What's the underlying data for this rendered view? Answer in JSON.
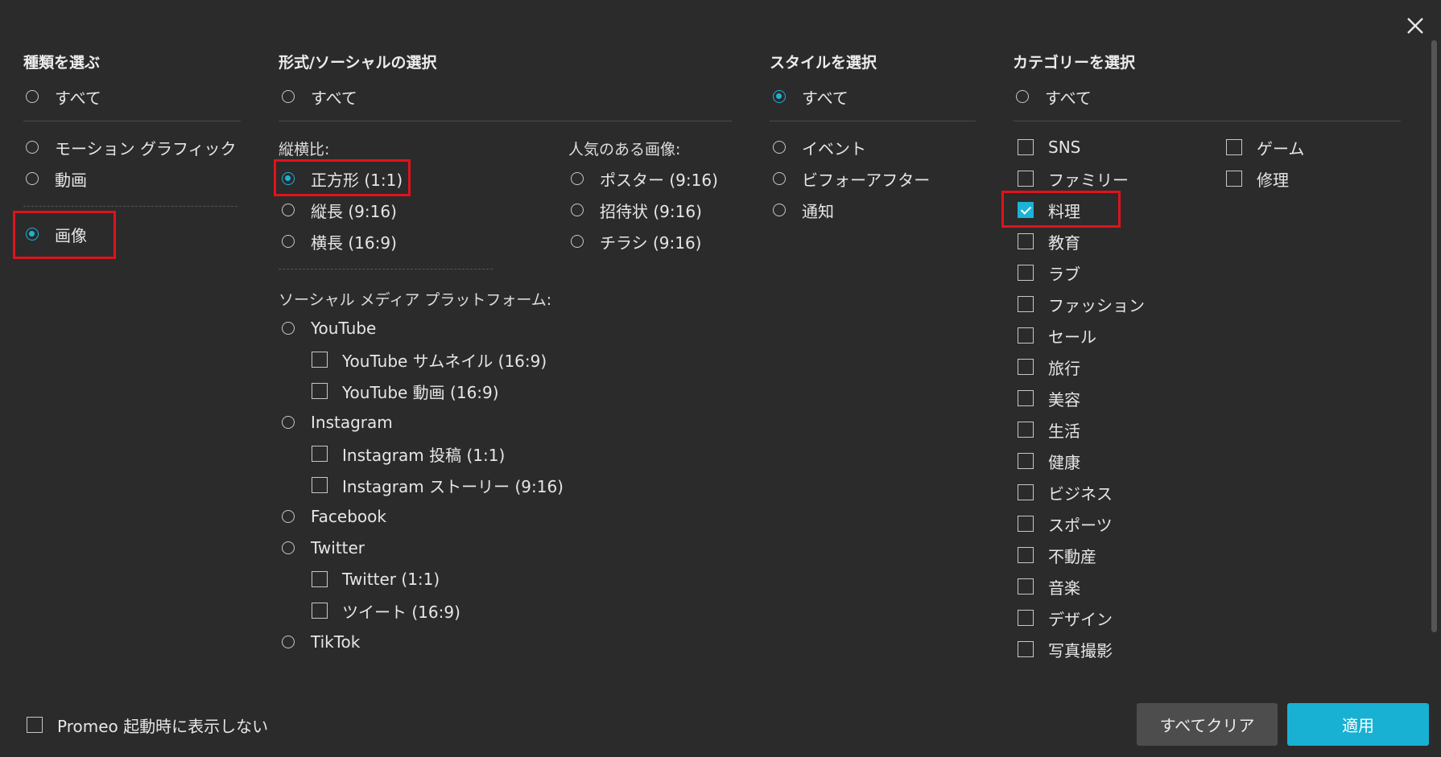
{
  "colors": {
    "accent": "#1bb3d6",
    "highlight": "#e0121b",
    "background": "#2b2b2b"
  },
  "close_icon": "close-icon",
  "type": {
    "heading": "種類を選ぶ",
    "all": "すべて",
    "motion": "モーション グラフィック",
    "video": "動画",
    "image": "画像"
  },
  "format": {
    "heading": "形式/ソーシャルの選択",
    "all": "すべて",
    "aspect_label": "縦横比:",
    "square": "正方形 (1:1)",
    "portrait": "縦長 (9:16)",
    "landscape": "横長 (16:9)",
    "popular_label": "人気のある画像:",
    "poster": "ポスター (9:16)",
    "invitation": "招待状 (9:16)",
    "flyer": "チラシ (9:16)",
    "social_label": "ソーシャル メディア プラットフォーム:",
    "youtube": "YouTube",
    "youtube_thumb": "YouTube サムネイル (16:9)",
    "youtube_video": "YouTube 動画 (16:9)",
    "instagram": "Instagram",
    "instagram_post": "Instagram 投稿 (1:1)",
    "instagram_story": "Instagram ストーリー (9:16)",
    "facebook": "Facebook",
    "twitter": "Twitter",
    "twitter_square": "Twitter (1:1)",
    "tweet": "ツイート (16:9)",
    "tiktok": "TikTok"
  },
  "style": {
    "heading": "スタイルを選択",
    "all": "すべて",
    "event": "イベント",
    "before_after": "ビフォーアフター",
    "notice": "通知"
  },
  "category": {
    "heading": "カテゴリーを選択",
    "all": "すべて",
    "items": [
      "SNS",
      "ファミリー",
      "料理",
      "教育",
      "ラブ",
      "ファッション",
      "セール",
      "旅行",
      "美容",
      "生活",
      "健康",
      "ビジネス",
      "スポーツ",
      "不動産",
      "音楽",
      "デザイン",
      "写真撮影"
    ],
    "items2": [
      "ゲーム",
      "修理"
    ]
  },
  "footer": {
    "dont_show": "Promeo 起動時に表示しない",
    "clear_all": "すべてクリア",
    "apply": "適用"
  }
}
